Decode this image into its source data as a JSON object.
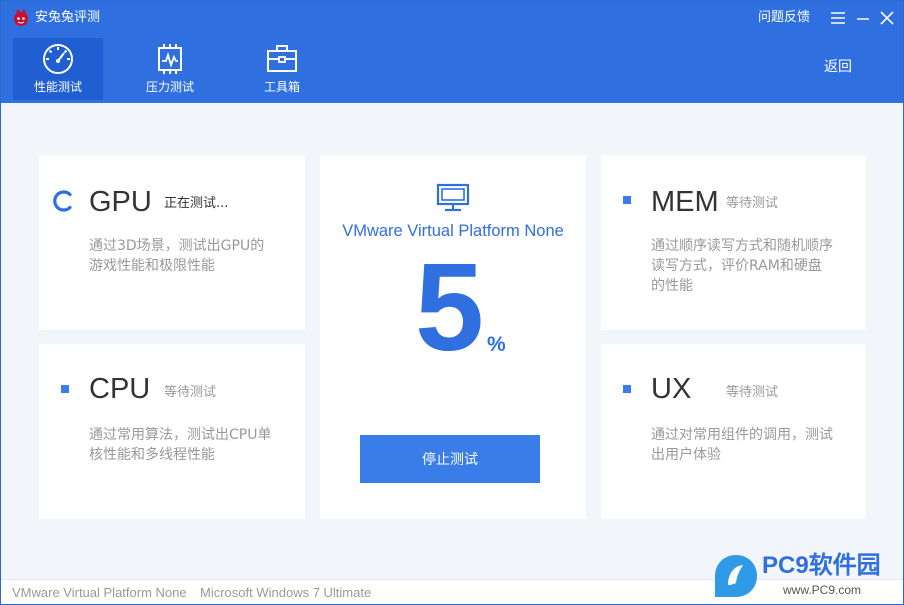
{
  "app": {
    "title": "安兔兔评测",
    "feedback_label": "问题反馈",
    "back_label": "返回",
    "colors": {
      "primary": "#2f6fe0",
      "active_tab": "#1f5fd2",
      "background": "#f2f5f9"
    }
  },
  "nav": {
    "tabs": [
      {
        "label": "性能测试",
        "icon": "speedometer-icon",
        "active": true
      },
      {
        "label": "压力测试",
        "icon": "chip-pulse-icon",
        "active": false
      },
      {
        "label": "工具箱",
        "icon": "toolbox-icon",
        "active": false
      }
    ]
  },
  "tests": {
    "gpu": {
      "name": "GPU",
      "status": "正在测试...",
      "desc_lines": [
        "通过3D场景，测试出GPU的",
        "游戏性能和极限性能"
      ]
    },
    "cpu": {
      "name": "CPU",
      "status": "等待测试",
      "desc_lines": [
        "通过常用算法，测试出CPU单",
        "核性能和多线程性能"
      ]
    },
    "mem": {
      "name": "MEM",
      "status": "等待测试",
      "desc_lines": [
        "通过顺序读写方式和随机顺序",
        "读写方式，评价RAM和硬盘",
        "的性能"
      ]
    },
    "ux": {
      "name": "UX",
      "status": "等待测试",
      "desc_lines": [
        "通过对常用组件的调用，测试",
        "出用户体验"
      ]
    }
  },
  "center": {
    "device_icon": "monitor-icon",
    "platform": "VMware Virtual Platform None",
    "progress": 5,
    "progress_text": "5",
    "progress_unit": "%",
    "stop_label": "停止测试"
  },
  "statusbar": {
    "platform": "VMware Virtual Platform None",
    "os": "Microsoft Windows 7 Ultimate"
  },
  "watermark": {
    "brand": "PC9软件园",
    "url": "www.PC9.com"
  }
}
